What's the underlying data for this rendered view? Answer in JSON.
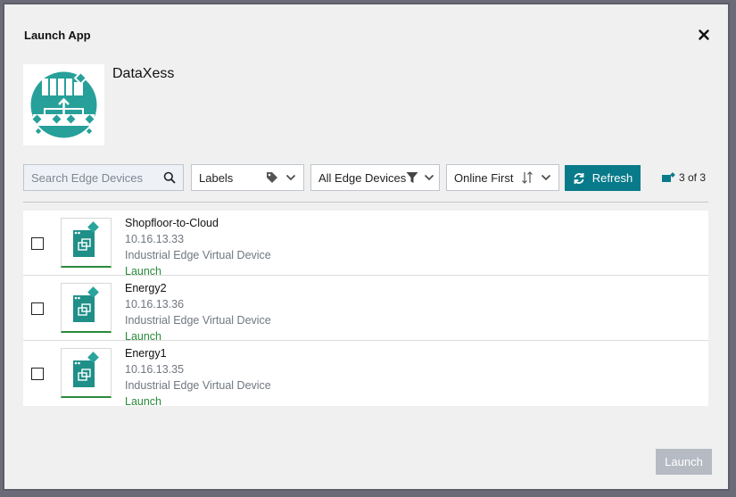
{
  "dialog": {
    "title": "Launch App"
  },
  "app": {
    "name": "DataXess"
  },
  "filters": {
    "search_placeholder": "Search Edge Devices",
    "labels": "Labels",
    "device_filter": "All Edge Devices",
    "sort": "Online First"
  },
  "refresh_label": "Refresh",
  "count_label": "3 of 3",
  "devices": [
    {
      "name": "Shopfloor-to-Cloud",
      "ip": "10.16.13.33",
      "type": "Industrial Edge Virtual Device",
      "action": "Launch"
    },
    {
      "name": "Energy2",
      "ip": "10.16.13.36",
      "type": "Industrial Edge Virtual Device",
      "action": "Launch"
    },
    {
      "name": "Energy1",
      "ip": "10.16.13.35",
      "type": "Industrial Edge Virtual Device",
      "action": "Launch"
    }
  ],
  "footer": {
    "launch_label": "Launch"
  },
  "colors": {
    "accent": "#087a8a",
    "launch_link": "#2a8a3c",
    "logo": "#27a09a"
  }
}
